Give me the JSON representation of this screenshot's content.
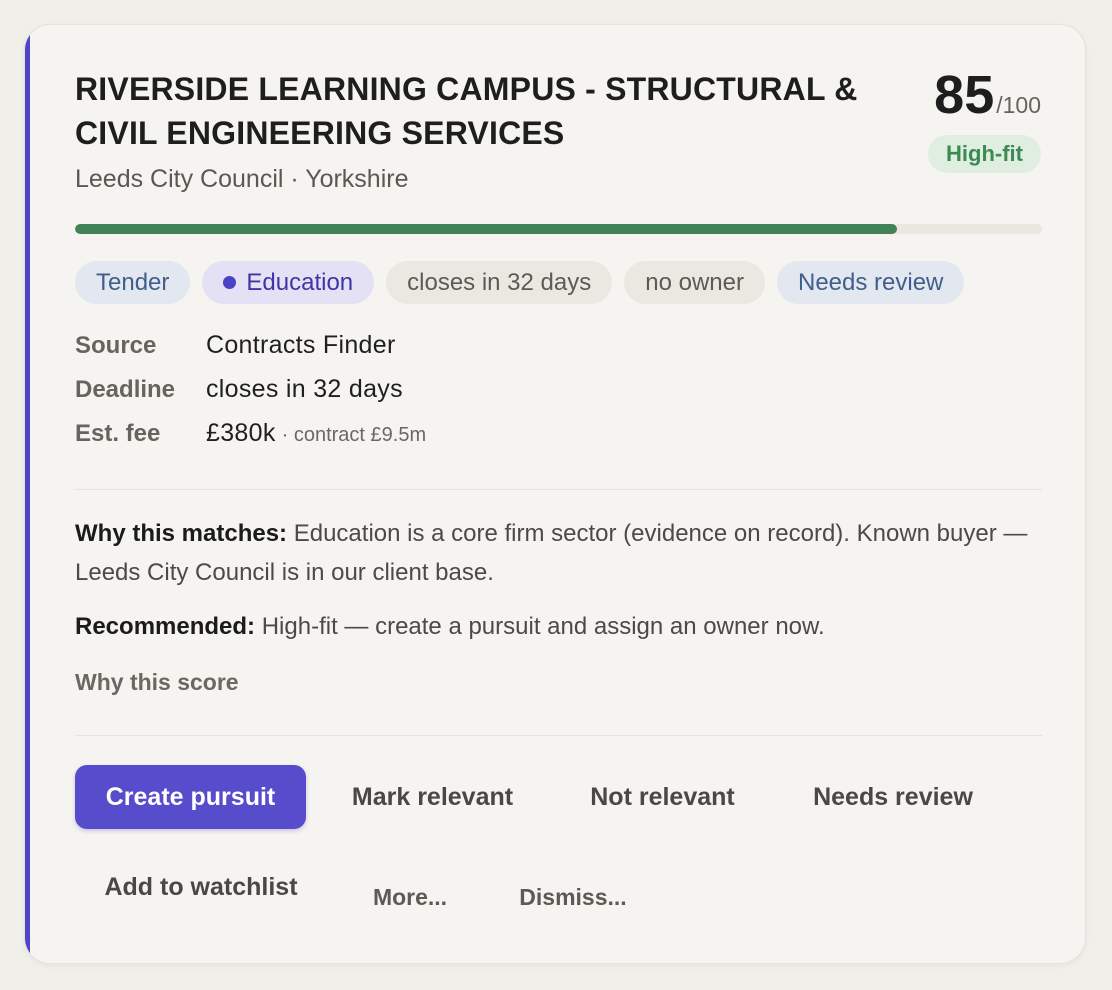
{
  "card": {
    "title": "RIVERSIDE LEARNING CAMPUS - STRUCTURAL & CIVIL ENGINEERING SERVICES",
    "subtitle": "Leeds City Council · Yorkshire",
    "score": {
      "value": "85",
      "max": "/100",
      "fit_label": "High-fit",
      "progress_percent": 85
    },
    "tags": [
      {
        "label": "Tender",
        "style": "blue"
      },
      {
        "label": "Education",
        "style": "purple",
        "icon": "dot-icon"
      },
      {
        "label": "closes in 32 days",
        "style": "grey"
      },
      {
        "label": "no owner",
        "style": "grey"
      },
      {
        "label": "Needs review",
        "style": "blue"
      }
    ],
    "details": {
      "source_label": "Source",
      "source_value": "Contracts Finder",
      "deadline_label": "Deadline",
      "deadline_value": "closes in 32 days",
      "fee_label": "Est. fee",
      "fee_value": "£380k",
      "fee_sub": "· contract £9.5m"
    },
    "why_matches": {
      "label": "Why this matches:",
      "text": "Education is a core firm sector (evidence on record). Known buyer — Leeds City Council is in our client base."
    },
    "recommended": {
      "label": "Recommended:",
      "text": "High-fit — create a pursuit and assign an owner now."
    },
    "why_score_link": "Why this score",
    "actions": {
      "create_pursuit": "Create pursuit",
      "mark_relevant": "Mark relevant",
      "not_relevant": "Not relevant",
      "needs_review": "Needs review",
      "add_to_watchlist": "Add to watchlist",
      "more": "More...",
      "dismiss": "Dismiss..."
    }
  },
  "colors": {
    "accent": "#4d44c9",
    "primary_button": "#574ccb",
    "progress_fill": "#418256",
    "fit_badge_bg": "#e0eee1",
    "fit_badge_text": "#3c8a51"
  }
}
